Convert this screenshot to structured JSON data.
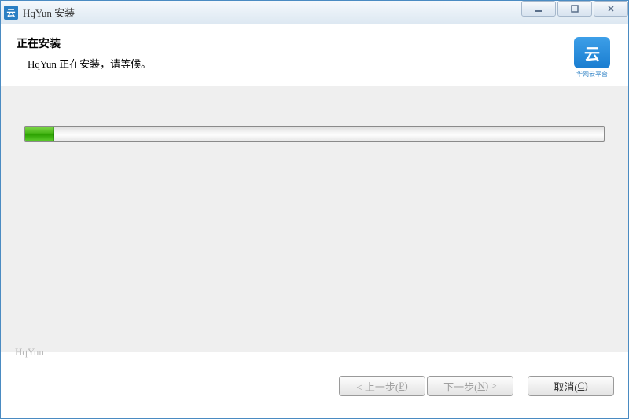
{
  "window": {
    "title": "HqYun 安装",
    "icon_glyph": "云"
  },
  "header": {
    "title": "正在安装",
    "subtitle": "HqYun 正在安装，请等候。"
  },
  "brand": {
    "logo_glyph": "云",
    "logo_caption": "华网云平台"
  },
  "progress": {
    "percent": 5
  },
  "footer": {
    "brand": "HqYun"
  },
  "buttons": {
    "back_prefix": "< 上一步(",
    "back_hotkey": "P",
    "back_suffix": ")",
    "next_prefix": "下一步(",
    "next_hotkey": "N",
    "next_suffix": ") >",
    "cancel_prefix": "取消(",
    "cancel_hotkey": "C",
    "cancel_suffix": ")"
  }
}
